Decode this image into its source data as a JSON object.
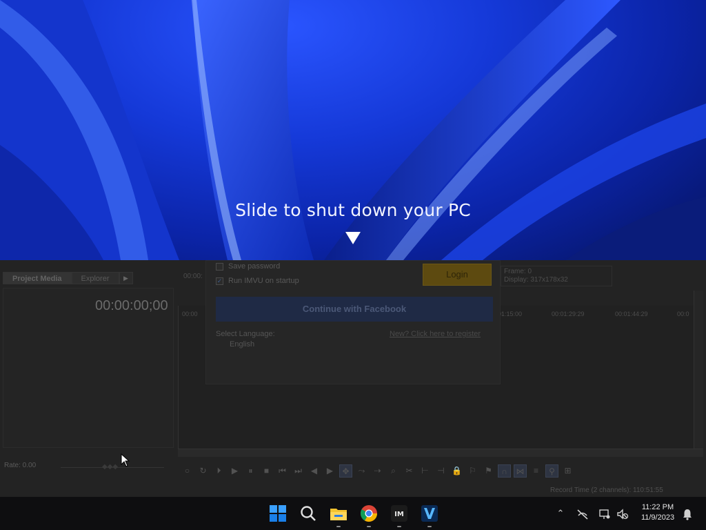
{
  "shutdown": {
    "title": "Slide to shut down your PC"
  },
  "editor": {
    "tabs": [
      "Project Media",
      "Explorer"
    ],
    "timecode": "00:00:00;00",
    "top_timecode": "00:00:",
    "frame_label": "Frame:",
    "frame_value": "0",
    "display_label": "Display:",
    "display_value": "317x178x32",
    "rate_label": "Rate: 0.00",
    "ruler_marks": [
      "00:00",
      "01:15:00",
      "00:01:29:29",
      "00:01:44:29",
      "00:0"
    ],
    "record_time": "Record Time (2 channels): 110:51:55"
  },
  "login": {
    "save_password": "Save password",
    "save_password_checked": false,
    "run_on_startup": "Run IMVU on startup",
    "run_on_startup_checked": true,
    "login_button": "Login",
    "facebook_button": "Continue with Facebook",
    "language_label": "Select Language:",
    "language_value": "English",
    "register_link": "New? Click here to register"
  },
  "taskbar": {
    "apps": [
      "start-icon",
      "search-icon",
      "file-explorer-icon",
      "chrome-icon",
      "imvu-icon",
      "vegas-icon"
    ],
    "time": "11:22 PM",
    "date": "11/9/2023"
  },
  "colors": {
    "wallpaper_blue": "#1539d8",
    "login_gold": "#5d4a10",
    "facebook_blue": "#1f2a45"
  }
}
